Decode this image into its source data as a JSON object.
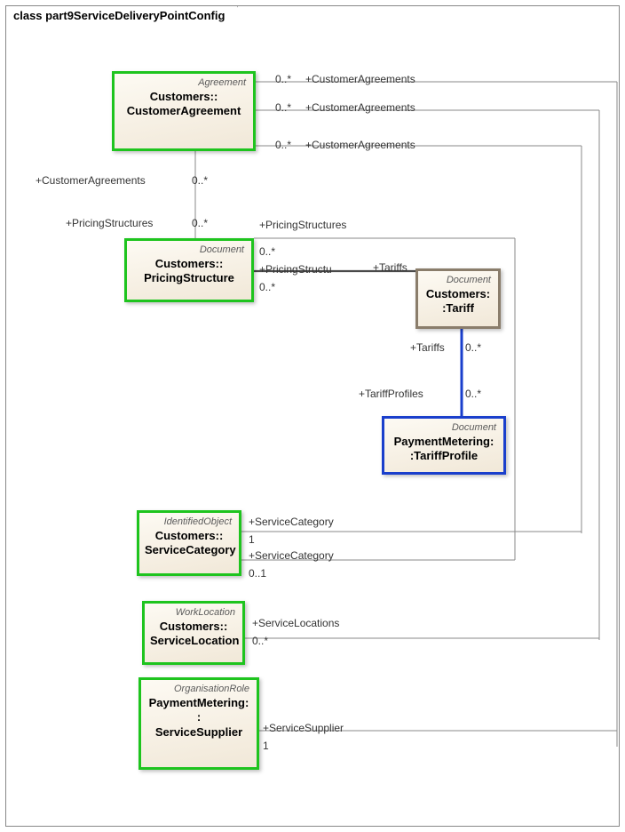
{
  "diagram_title": "class part9ServiceDeliveryPointConfig",
  "classes": {
    "customer_agreement": {
      "stereo": "Agreement",
      "name": "Customers::\nCustomerAgreement"
    },
    "pricing_structure": {
      "stereo": "Document",
      "name": "Customers::\nPricingStructure"
    },
    "tariff": {
      "stereo": "Document",
      "name": "Customers:\n:Tariff"
    },
    "tariff_profile": {
      "stereo": "Document",
      "name": "PaymentMetering:\n:TariffProfile"
    },
    "service_category": {
      "stereo": "IdentifiedObject",
      "name": "Customers::\nServiceCategory"
    },
    "service_location": {
      "stereo": "WorkLocation",
      "name": "Customers::\nServiceLocation"
    },
    "service_supplier": {
      "stereo": "OrganisationRole",
      "name": "PaymentMetering:\n:\nServiceSupplier"
    }
  },
  "labels": {
    "ca_top1_m": "0..*",
    "ca_top1_r": "+CustomerAgreements",
    "ca_top2_m": "0..*",
    "ca_top2_r": "+CustomerAgreements",
    "ca_top3_m": "0..*",
    "ca_top3_r": "+CustomerAgreements",
    "ca_ps_left": "+CustomerAgreements",
    "ca_ps_left_m": "0..*",
    "ps_left": "+PricingStructures",
    "ps_left_m": "0..*",
    "ps_right_top": "+PricingStructures",
    "ps_right_m1": "0..*",
    "ps_right_role": "+PricingStructu",
    "ps_right_m2": "0..*",
    "tariffs_top_role": "+Tariffs",
    "tariffs_mid_role": "+Tariffs",
    "tariffs_mid_m": "0..*",
    "tp_role": "+TariffProfiles",
    "tp_m": "0..*",
    "sc_top_role": "+ServiceCategory",
    "sc_top_m": "1",
    "sc_bot_role": "+ServiceCategory",
    "sc_bot_m": "0..1",
    "sl_role": "+ServiceLocations",
    "sl_m": "0..*",
    "ss_role": "+ServiceSupplier",
    "ss_m": "1"
  }
}
